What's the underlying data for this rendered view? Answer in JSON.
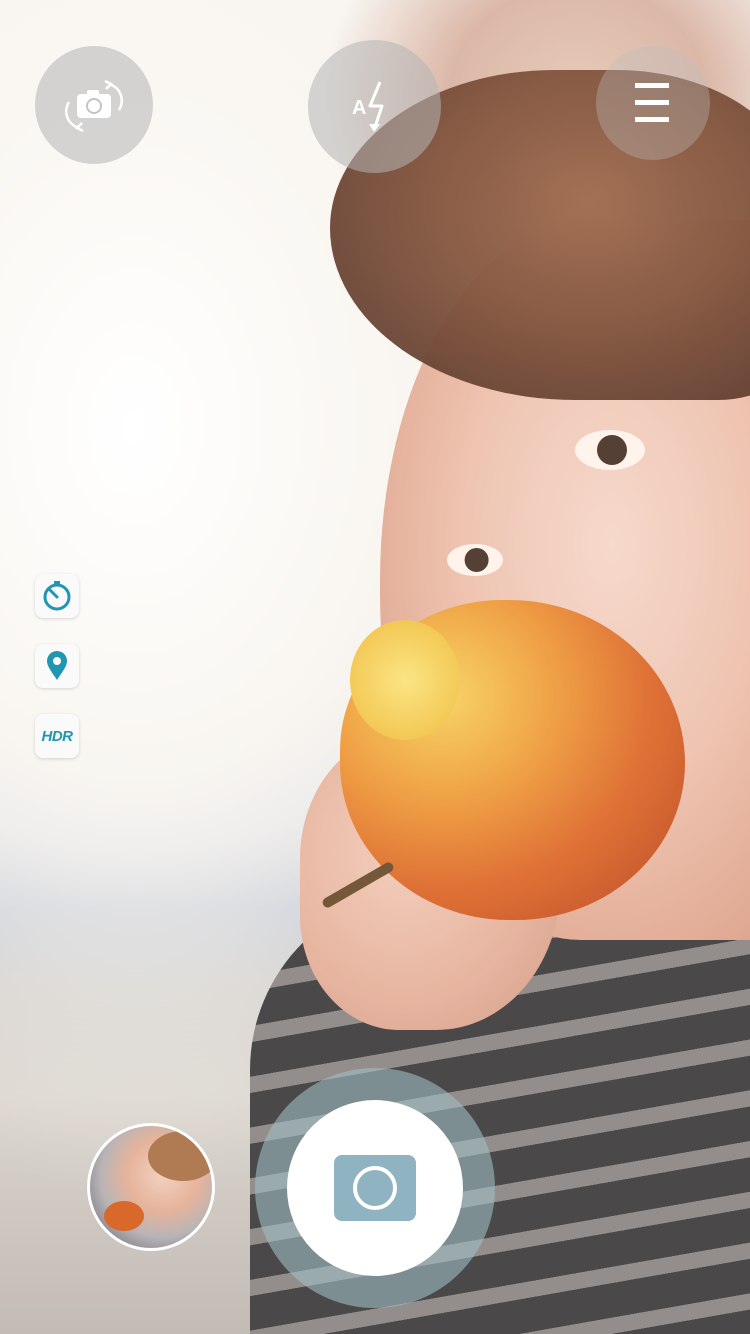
{
  "screen": "camera-viewfinder",
  "top_bar": {
    "switch_camera": {
      "icon": "camera-switch-icon"
    },
    "flash": {
      "icon": "flash-auto-icon",
      "mode_label": "A"
    },
    "menu": {
      "icon": "hamburger-menu-icon"
    }
  },
  "side_controls": {
    "timer": {
      "icon": "timer-icon"
    },
    "location": {
      "icon": "location-pin-icon"
    },
    "hdr": {
      "label": "HDR"
    }
  },
  "bottom_bar": {
    "gallery_thumbnail": {
      "icon": "last-photo-thumbnail"
    },
    "shutter": {
      "icon": "camera-icon"
    }
  },
  "colors": {
    "accent": "#2196b2",
    "shutter_icon": "#8fb3c0",
    "shutter_ring": "#a0bec3"
  }
}
